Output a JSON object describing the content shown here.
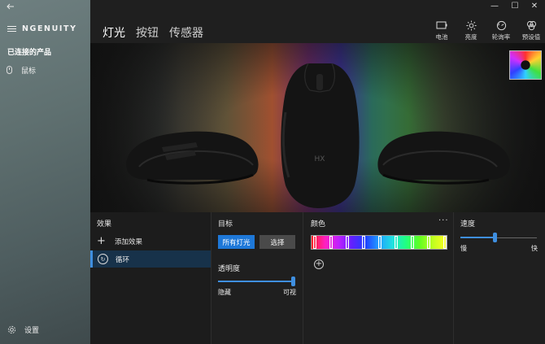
{
  "app": {
    "brand": "NGENUITY"
  },
  "sidebar": {
    "connected_title": "已连接的产品",
    "devices": [
      {
        "label": "鼠标"
      }
    ],
    "settings_label": "设置"
  },
  "tabs": [
    {
      "label": "灯光",
      "active": true
    },
    {
      "label": "按钮"
    },
    {
      "label": "传感器"
    }
  ],
  "toolbar": [
    {
      "label": "电池",
      "icon": "battery-icon"
    },
    {
      "label": "亮度",
      "icon": "brightness-icon"
    },
    {
      "label": "轮询率",
      "icon": "polling-rate-icon"
    },
    {
      "label": "预设值",
      "icon": "presets-icon"
    }
  ],
  "effects_panel": {
    "title": "效果",
    "add_label": "添加效果",
    "items": [
      {
        "label": "循环",
        "selected": true
      }
    ]
  },
  "target_panel": {
    "title": "目标",
    "all_lights_label": "所有灯光",
    "select_label": "选择",
    "opacity_title": "透明度",
    "opacity_min_label": "隐藏",
    "opacity_max_label": "可视",
    "opacity_value": 1.0
  },
  "color_panel": {
    "title": "颜色",
    "more_label": "···",
    "stops_count": 9
  },
  "speed_panel": {
    "title": "速度",
    "min_label": "慢",
    "max_label": "快",
    "value": 0.45
  },
  "colors": {
    "accent": "#1e78d8",
    "selected_bg": "#17324a"
  }
}
